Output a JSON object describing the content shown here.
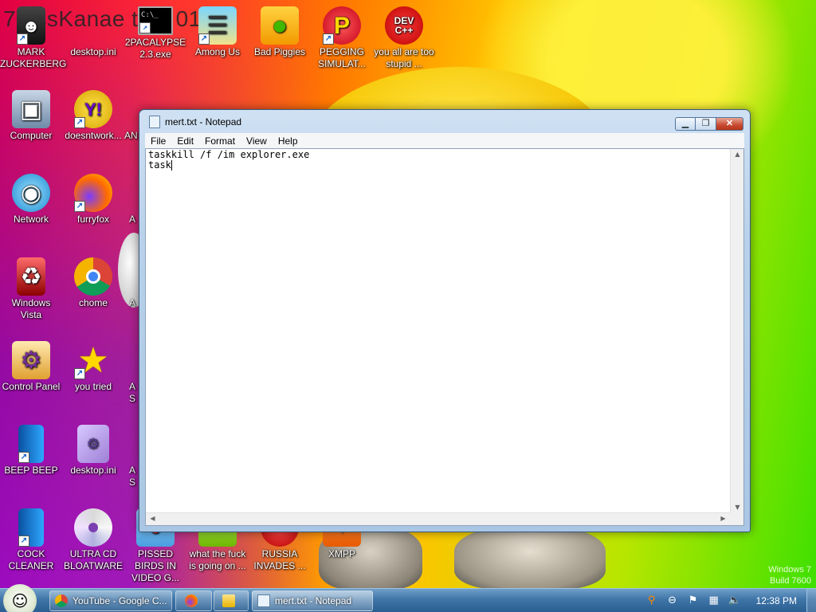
{
  "wallpaper": {
    "title_text": "7 ossKanae tion 012"
  },
  "watermark": {
    "line1": "Windows 7",
    "line2": "Build 7600"
  },
  "desktop_icons": [
    {
      "label": "MARK ZUCKERBERG",
      "icon": "person-icon"
    },
    {
      "label": "desktop.ini",
      "icon": "ini-file-icon"
    },
    {
      "label": "2PACALYPSE 2.3.exe",
      "icon": "console-icon"
    },
    {
      "label": "Among Us",
      "icon": "among-us-icon"
    },
    {
      "label": "Bad Piggies",
      "icon": "bad-piggies-icon"
    },
    {
      "label": "PEGGING SIMULAT...",
      "icon": "p-logo-icon"
    },
    {
      "label": "you all are too stupid ...",
      "icon": "dev-cpp-icon"
    },
    {
      "label": "Computer",
      "icon": "computer-icon"
    },
    {
      "label": "doesntwork...",
      "icon": "yahoo-icon"
    },
    {
      "label": "Network",
      "icon": "network-icon"
    },
    {
      "label": "furryfox",
      "icon": "firefox-icon"
    },
    {
      "label": "Windows Vista",
      "icon": "recycle-bin-icon"
    },
    {
      "label": "chome",
      "icon": "chrome-icon"
    },
    {
      "label": "Control Panel",
      "icon": "control-panel-icon"
    },
    {
      "label": "you tried",
      "icon": "star-icon"
    },
    {
      "label": "BEEP BEEP",
      "icon": "blue-book-icon"
    },
    {
      "label": "desktop.ini",
      "icon": "ini-file-icon"
    },
    {
      "label": "COCK CLEANER",
      "icon": "blue-book-icon"
    },
    {
      "label": "ULTRA CD BLOATWARE",
      "icon": "cd-icon"
    },
    {
      "label": "PISSED BIRDS IN VIDEO G...",
      "icon": "angry-birds-icon"
    },
    {
      "label": "what the fuck is going on ...",
      "icon": "game-icon"
    },
    {
      "label": "RUSSIA INVADES ...",
      "icon": "game-icon"
    },
    {
      "label": "XMPP",
      "icon": "xmpp-icon"
    }
  ],
  "partial_labels": [
    "AN",
    "A",
    "A",
    "A S",
    "A S"
  ],
  "notepad": {
    "title": "mert.txt - Notepad",
    "menus": [
      "File",
      "Edit",
      "Format",
      "View",
      "Help"
    ],
    "lines": [
      "taskkill /f /im explorer.exe",
      "task"
    ]
  },
  "taskbar": {
    "tasks": [
      {
        "label": "YouTube - Google C...",
        "icon": "chrome-icon"
      },
      {
        "label": "",
        "icon": "firefox-icon"
      },
      {
        "label": "",
        "icon": "folder-icon"
      },
      {
        "label": "mert.txt - Notepad",
        "icon": "notepad-icon"
      }
    ],
    "clock": "12:38 PM"
  }
}
